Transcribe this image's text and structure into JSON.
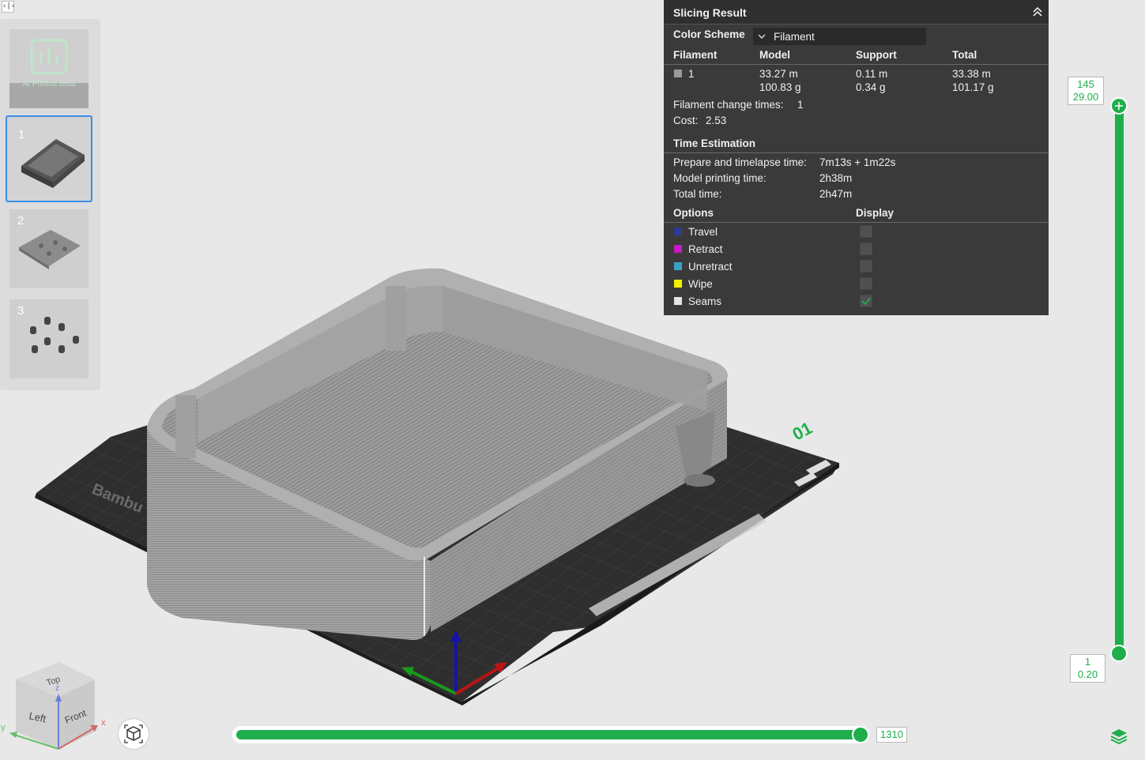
{
  "toolbar": {
    "toggle_label": "‹|›"
  },
  "plates": [
    {
      "label": "",
      "thumb_text": "AI Photos Beta",
      "selected": false
    },
    {
      "label": "1",
      "selected": true
    },
    {
      "label": "2",
      "selected": false
    },
    {
      "label": "3",
      "selected": false
    }
  ],
  "bed": {
    "brand_text": "Bambu Textured PEI Plate",
    "plate_number": "01"
  },
  "slicing_result": {
    "title": "Slicing Result",
    "color_scheme_label": "Color Scheme",
    "color_scheme_value": "Filament",
    "filament_table": {
      "headers": [
        "Filament",
        "Model",
        "Support",
        "Total"
      ],
      "rows": [
        {
          "filament": "1",
          "color": "#9a9a9a",
          "model_length": "33.27 m",
          "model_weight": "100.83 g",
          "support_length": "0.11 m",
          "support_weight": "0.34 g",
          "total_length": "33.38 m",
          "total_weight": "101.17 g"
        }
      ]
    },
    "filament_change_label": "Filament change times:",
    "filament_change_value": "1",
    "cost_label": "Cost:",
    "cost_value": "2.53",
    "time_estimation_title": "Time Estimation",
    "prepare_label": "Prepare and timelapse time:",
    "prepare_value": "7m13s + 1m22s",
    "model_time_label": "Model printing time:",
    "model_time_value": "2h38m",
    "total_time_label": "Total time:",
    "total_time_value": "2h47m",
    "options_header": "Options",
    "display_header": "Display",
    "options": [
      {
        "label": "Travel",
        "color": "#2d3b8f",
        "checked": false
      },
      {
        "label": "Retract",
        "color": "#c419c4",
        "checked": false
      },
      {
        "label": "Unretract",
        "color": "#3aa0c8",
        "checked": false
      },
      {
        "label": "Wipe",
        "color": "#f2f200",
        "checked": false
      },
      {
        "label": "Seams",
        "color": "#e6e6e6",
        "checked": true
      }
    ]
  },
  "layer_slider": {
    "top_layer": "145",
    "top_height": "29.00",
    "bottom_layer": "1",
    "bottom_height": "0.20",
    "accent": "#1fae4c"
  },
  "move_slider": {
    "value": "1310"
  },
  "nav_cube": {
    "top": "Top",
    "left": "Left",
    "front": "Front",
    "axis_x": "x",
    "axis_y": "y",
    "axis_z": "z"
  }
}
